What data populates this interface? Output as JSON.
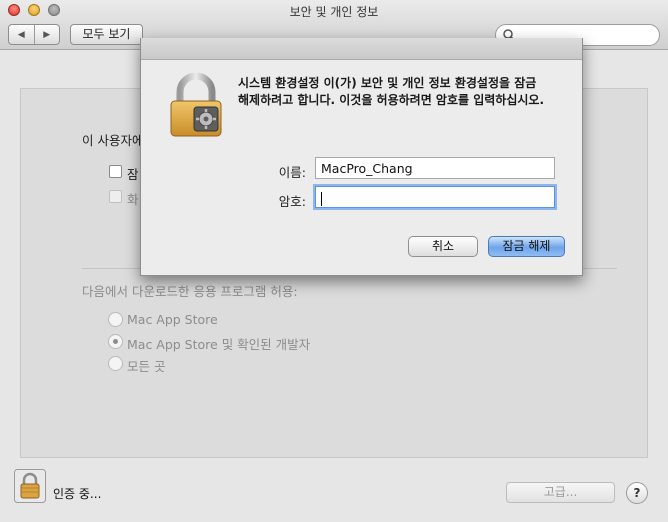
{
  "window": {
    "title": "보안 및 개인 정보",
    "back_glyph": "◀",
    "forward_glyph": "▶",
    "show_all_label": "모두 보기",
    "search_placeholder": ""
  },
  "pane": {
    "user_line_partial": "이 사용자에",
    "checkbox_1_partial": "잠",
    "checkbox_2_partial": "화",
    "allow_apps_label": "다음에서 다운로드한 응용 프로그램 허용:",
    "radio_options": [
      {
        "label": "Mac App Store",
        "checked": false
      },
      {
        "label": "Mac App Store 및 확인된 개발자",
        "checked": true
      },
      {
        "label": "모든 곳",
        "checked": false
      }
    ]
  },
  "bottom": {
    "status_label": "인증 중...",
    "advanced_label": "고급...",
    "help_label": "?"
  },
  "auth_sheet": {
    "message_line1": "시스템 환경설정 이(가) 보안 및 개인 정보 환경설정을 잠금",
    "message_line2": "해제하려고 합니다. 이것을 허용하려면 암호를 입력하십시오.",
    "name_label": "이름:",
    "name_value": "MacPro_Chang",
    "password_label": "암호:",
    "password_value": "",
    "cancel_label": "취소",
    "unlock_label": "잠금 해제"
  },
  "colors": {
    "primary_button": "#6fa4ea",
    "focus_ring": "#8bb7ee",
    "lock_gold": "#d9a441"
  }
}
